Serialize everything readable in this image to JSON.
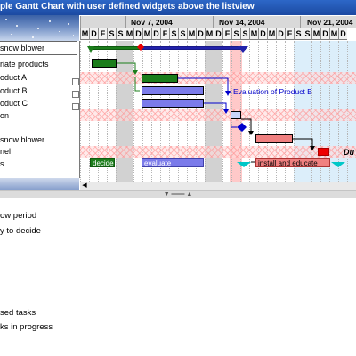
{
  "window": {
    "title": "ple Gantt Chart with user defined widgets above the listview"
  },
  "weeks": [
    "Nov 7, 2004",
    "Nov 14, 2004",
    "Nov 21, 2004"
  ],
  "days": [
    "M",
    "D",
    "F",
    "S",
    "S",
    "M",
    "D",
    "M",
    "D",
    "F",
    "S",
    "S",
    "M",
    "D",
    "M",
    "D",
    "F",
    "S",
    "S",
    "M",
    "D",
    "M",
    "D",
    "F",
    "S",
    "S",
    "M",
    "D",
    "M",
    "D"
  ],
  "task_list": [
    {
      "label": "snow blower",
      "bordered": true
    },
    {
      "label": "riate products",
      "bordered": false
    },
    {
      "label": "oduct A",
      "bordered": false
    },
    {
      "label": "oduct B",
      "bordered": false
    },
    {
      "label": "oduct C",
      "bordered": false
    },
    {
      "label": "on",
      "bordered": false
    },
    {
      "label": "",
      "bordered": false
    },
    {
      "label": "snow blower",
      "bordered": false
    },
    {
      "label": "nel",
      "bordered": false
    },
    {
      "label": "s",
      "bordered": false
    }
  ],
  "bar_labels": {
    "evaluation_product_b": "Evaluation of Product B",
    "decide": "decide",
    "evaluate": "evaluate",
    "install_educate": "install and educate",
    "du": "Du"
  },
  "legend": [
    "ow period",
    "y to decide",
    "sed tasks",
    "ks in progress"
  ],
  "colors": {
    "green": "#1b7d1b",
    "blue": "#0000cc",
    "lavender": "#7b7bea",
    "salmon": "#f08080",
    "red": "#ee0000",
    "cyan": "#00c8c8",
    "today": "#ffc9c9",
    "future": "#dceefa"
  }
}
